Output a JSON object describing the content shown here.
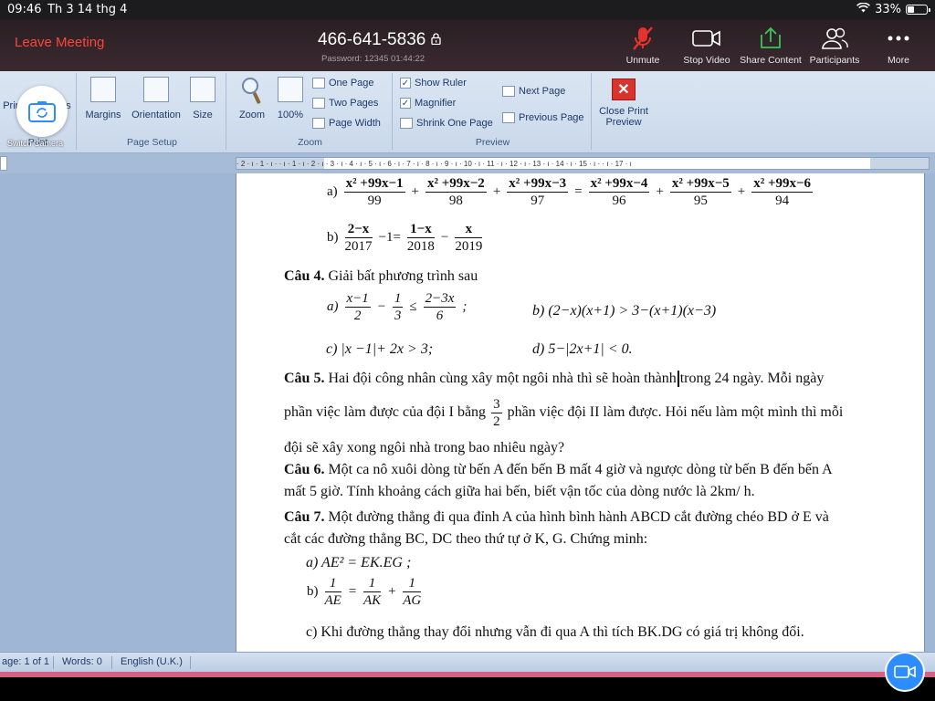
{
  "status_bar": {
    "time": "09:46",
    "date": "Th 3 14 thg 4",
    "battery": "33%"
  },
  "zoom": {
    "leave": "Leave Meeting",
    "meeting_id": "466-641-5836",
    "password_line": "Password: 12345   01:44:22",
    "buttons": {
      "unmute": "Unmute",
      "stop_video": "Stop Video",
      "share": "Share Content",
      "participants": "Participants",
      "more": "More"
    },
    "accent_red": "#ff453a",
    "accent_green": "#34c759"
  },
  "ribbon": {
    "print_partial": "Prin",
    "print_group": "Print",
    "switch_camera": "Switch Camera",
    "s_partial": "s",
    "margins": "Margins",
    "orientation": "Orientation",
    "size": "Size",
    "page_setup": "Page Setup",
    "zoom_btn": "Zoom",
    "zoom_100": "100%",
    "one_page": "One Page",
    "two_pages": "Two Pages",
    "page_width": "Page Width",
    "zoom_group": "Zoom",
    "show_ruler": "Show Ruler",
    "magnifier": "Magnifier",
    "shrink": "Shrink One Page",
    "next_page": "Next Page",
    "previous_page": "Previous Page",
    "close_print_1": "Close Print",
    "close_print_2": "Preview",
    "preview_group": "Preview"
  },
  "ruler": {
    "text": "· 2 · ı · 1 · ı ·   · ı · 1 · ı · 2 · ı · 3 · ı · 4 · ı · 5 · ı · 6 · ı · 7 · ı · 8 · ı · 9 · ı · 10 · ı · 11 · ı · 12 · ı · 13 · ı · 14 · ı · 15 · ı ·   · ı · 17 · ı"
  },
  "doc": {
    "a_label": "a)",
    "eq_a": {
      "nums": [
        "x² +99x−1",
        "x² +99x−2",
        "x² +99x−3",
        "x² +99x−4",
        "x² +99x−5",
        "x² +99x−6"
      ],
      "dens": [
        "99",
        "98",
        "97",
        "96",
        "95",
        "94"
      ],
      "ops": [
        "+",
        "+",
        "=",
        "+",
        "+"
      ]
    },
    "b_label": "b)",
    "eq_b": {
      "n1": "2−x",
      "d1": "2017",
      "mid": "−1=",
      "n2": "1−x",
      "d2": "2018",
      "minus": "−",
      "n3": "x",
      "d3": "2019"
    },
    "cau4_bold": "Câu 4.",
    "cau4_text": " Giải bất phương trình sau",
    "c4a_label": "a)",
    "c4a": {
      "n1": "x−1",
      "d1": "2",
      "m": "−",
      "n2": "1",
      "d2": "3",
      "le": "≤",
      "n3": "2−3x",
      "d3": "6",
      "end": ";"
    },
    "c4b": "b) (2−x)(x+1) > 3−(x+1)(x−3)",
    "c4c": "c) |x −1|+ 2x > 3;",
    "c4d": "d) 5−|2x+1| < 0.",
    "cau5_bold": "Câu 5.",
    "cau5_l1a": " Hai đội công nhân cùng xây một ngôi nhà thì sẽ hoàn thành",
    "cau5_l1b": "trong 24 ngày. Mỗi ngày",
    "cau5_l2a": "phần việc làm được của đội I bằng",
    "cau5_frac_n": "3",
    "cau5_frac_d": "2",
    "cau5_l2b": "phần việc đội II làm được. Hỏi nếu làm một mình thì mỗi",
    "cau5_l3": "đội sẽ xây xong ngôi nhà trong bao nhiêu ngày?",
    "cau6_bold": "Câu 6.",
    "cau6_l1": " Một ca nô xuôi dòng từ bến A đến bến B mất 4 giờ và ngược dòng từ bến B đến bến A",
    "cau6_l2": "mất 5 giờ. Tính khoảng cách  giữa hai bến, biết vận tốc của dòng nước là  2km/ h.",
    "cau7_bold": "Câu 7.",
    "cau7_l1": " Một đường thẳng đi qua đỉnh A của  hình bình hành ABCD cắt đường chéo BD ở E và",
    "cau7_l2": "cắt các đường thẳng BC, DC theo thứ tự ở K, G. Chứng minh:",
    "c7a": "a)    AE² = EK.EG ;",
    "c7b_label": "b)",
    "c7b": {
      "n1": "1",
      "d1": "AE",
      "eq": "=",
      "n2": "1",
      "d2": "AK",
      "plus": "+",
      "n3": "1",
      "d3": "AG"
    },
    "c7c": "c)  Khi đường thẳng thay đổi nhưng vẫn đi qua A thì tích BK.DG có giá trị không đổi."
  },
  "word_status": {
    "page": "age: 1 of 1",
    "words": "Words: 0",
    "lang": "English (U.K.)"
  }
}
